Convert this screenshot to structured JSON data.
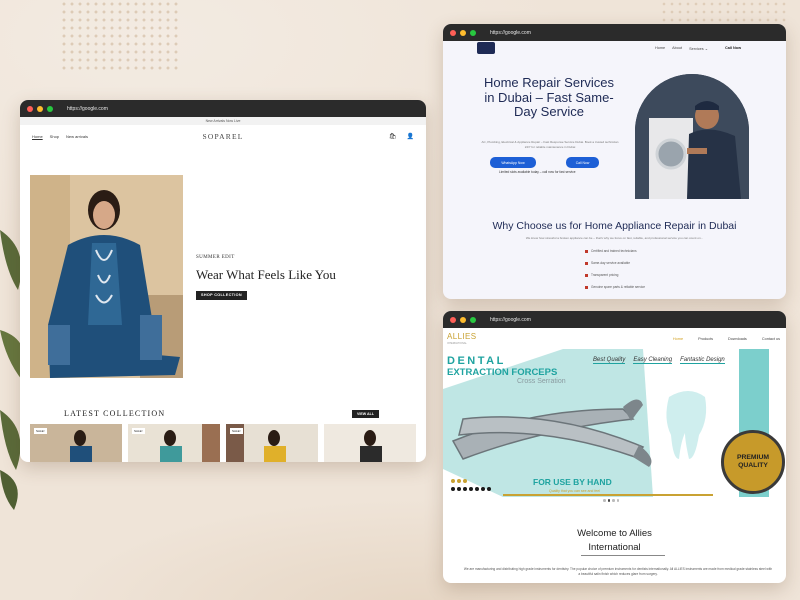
{
  "colors": {
    "accent_navy": "#1e2a55",
    "accent_blue": "#1d5fd6",
    "accent_teal": "#1fa3a0",
    "accent_gold": "#c79a2a"
  },
  "w1": {
    "url": "https://google.com",
    "announcement": "New Arrivals Now Live",
    "nav": [
      "Home",
      "Shop",
      "New arrivals"
    ],
    "logo": "SOPAREL",
    "hero": {
      "eyebrow": "SUMMER EDIT",
      "title": "Wear What Feels Like You",
      "button": "SHOP COLLECTION"
    },
    "latest_title": "LATEST COLLECTION",
    "view_all": "VIEW ALL",
    "sale_badge": "SALE!"
  },
  "w2": {
    "url": "https://google.com",
    "nav": [
      "Home",
      "About",
      "Services ⌄"
    ],
    "call": "Call Now",
    "hero_title": "Home Repair Services in Dubai – Fast Same-Day Service",
    "hero_sub": "AC, Plumbing, Electrical & Appliance Repair – Fast Response Service Dubai. Book a trusted technician 24/7 for reliable maintenance in Dubai",
    "btn_whatsapp": "WhatsApp Now",
    "btn_call": "Call Now",
    "note": "Limited slots available today – call now for fast service",
    "why_title": "Why Choose us for Home Appliance Repair in Dubai",
    "why_sub": "We know how stressful a broken appliance can be – that’s why we focus on fast, reliable, and professional service you can count on...",
    "checks": [
      "Certified and trained technicians",
      "Same-day service available",
      "Transparent pricing",
      "Genuine spare parts & reliable service"
    ]
  },
  "w3": {
    "url": "https://google.com",
    "logo": "ALLIES",
    "logo_sub": "INTERNATIONAL",
    "nav": [
      "Home",
      "Products",
      "Downloads",
      "Contact us"
    ],
    "banner": {
      "t1": "DENTAL",
      "t2": "EXTRACTION FORCEPS",
      "t3": "Cross Serration",
      "features": [
        "Best Quality",
        "Easy Cleaning",
        "Fantastic Design"
      ],
      "for_use": "FOR USE BY HAND",
      "quality_line": "Quality that you can see and feel",
      "premium_1": "PREMIUM",
      "premium_2": "QUALITY"
    },
    "welcome_1": "Welcome to Allies",
    "welcome_2": "International",
    "body": "We are manufacturing and distributing high grade instruments for dentistry. The popular choice of premium instruments for dentists internationally. All ALLIES instruments are made from medical grade stainless steel with a beautiful satin finish which reduces glare from surgery."
  }
}
